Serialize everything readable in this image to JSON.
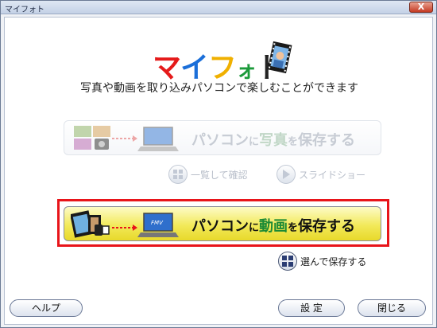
{
  "window": {
    "title": "マイフォト",
    "close_label": "X"
  },
  "logo": {
    "letters": [
      "マ",
      "イ",
      "フ",
      "ォ",
      "ト"
    ],
    "colors": [
      "#e51a1a",
      "#1b6fd9",
      "#f0b000",
      "#1b9a3a",
      "#222222"
    ]
  },
  "subtitle": "写真や動画を取り込みパソコンで楽しむことができます",
  "photo_button": {
    "prefix": "パソコン",
    "ni": "に",
    "target": "写真",
    "suffix_o": "を",
    "action": "保存する"
  },
  "view_list": {
    "label": "一覧して確認"
  },
  "slideshow": {
    "label": "スライドショー"
  },
  "video_button": {
    "prefix": "パソコン",
    "ni": "に",
    "target": "動画",
    "suffix_o": "を",
    "action": "保存する"
  },
  "select_save": {
    "label": "選んで保存する"
  },
  "footer": {
    "help": "ヘルプ",
    "settings": "設 定",
    "close": "閉じる"
  },
  "screen_label": "FMV"
}
